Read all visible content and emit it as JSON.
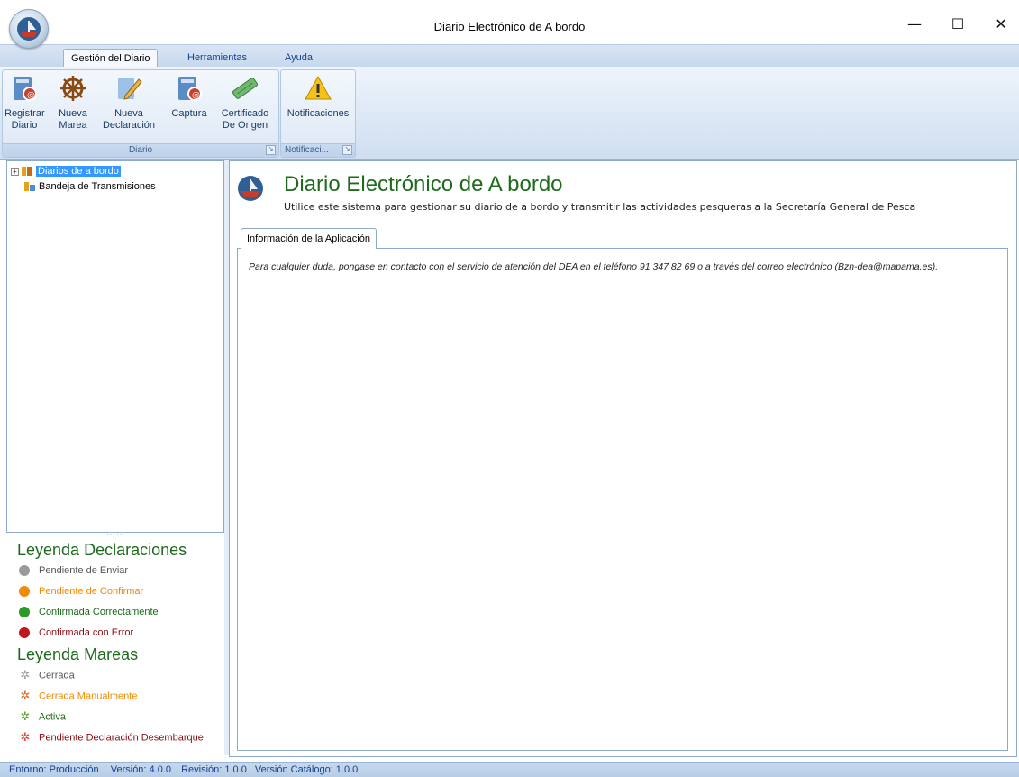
{
  "window": {
    "title": "Diario Electrónico de A bordo",
    "minimize": "—",
    "maximize": "☐",
    "close": "✕"
  },
  "ribbon": {
    "tabs": [
      "Gestión del Diario",
      "Herramientas",
      "Ayuda"
    ],
    "groups": [
      {
        "label": "Diario",
        "buttons": [
          {
            "line1": "Registrar",
            "line2": "Diario",
            "icon": "register-diary-icon"
          },
          {
            "line1": "Nueva",
            "line2": "Marea",
            "icon": "ship-wheel-icon"
          },
          {
            "line1": "Nueva",
            "line2": "Declaración",
            "icon": "pencil-icon"
          },
          {
            "line1": "Captura",
            "line2": "",
            "icon": "capture-icon"
          },
          {
            "line1": "Certificado",
            "line2": "De Origen",
            "icon": "certificate-icon"
          }
        ]
      },
      {
        "label": "Notificaci...",
        "buttons": [
          {
            "line1": "Notificaciones",
            "line2": "",
            "icon": "warning-icon"
          }
        ]
      }
    ]
  },
  "tree": {
    "items": [
      {
        "label": "Diarios de a bordo",
        "selected": true
      },
      {
        "label": "Bandeja de Transmisiones",
        "selected": false
      }
    ]
  },
  "legend": {
    "declaraciones_title": "Leyenda Declaraciones",
    "declaraciones": [
      {
        "label": "Pendiente de Enviar",
        "color": "#808080"
      },
      {
        "label": "Pendiente de Confirmar",
        "color": "#f08a00"
      },
      {
        "label": "Confirmada Correctamente",
        "color": "#1a7a1a"
      },
      {
        "label": "Confirmada con Error",
        "color": "#c0161d"
      }
    ],
    "mareas_title": "Leyenda Mareas",
    "mareas": [
      {
        "label": "Cerrada",
        "color": "#808080"
      },
      {
        "label": "Cerrada Manualmente",
        "color": "#f08a00"
      },
      {
        "label": "Activa",
        "color": "#1a7a1a"
      },
      {
        "label": "Pendiente Declaración Desembarque",
        "color": "#c0161d"
      }
    ]
  },
  "main": {
    "title": "Diario Electrónico de A bordo",
    "subtitle": "Utilice este sistema para gestionar su diario de a bordo y transmitir las actividades pesqueras a la Secretaría General de Pesca",
    "tab": "Información de la Aplicación",
    "info": "Para cualquier duda, pongase en contacto con el servicio de atención del DEA en el teléfono 91 347 82 69 o a través del correo electrónico (Bzn-dea@mapama.es)."
  },
  "status": {
    "entorno": "Entorno: Producción",
    "version": "Versión: 4.0.0",
    "revision": "Revisión: 1.0.0",
    "catalogo": "Versión Catálogo: 1.0.0"
  }
}
